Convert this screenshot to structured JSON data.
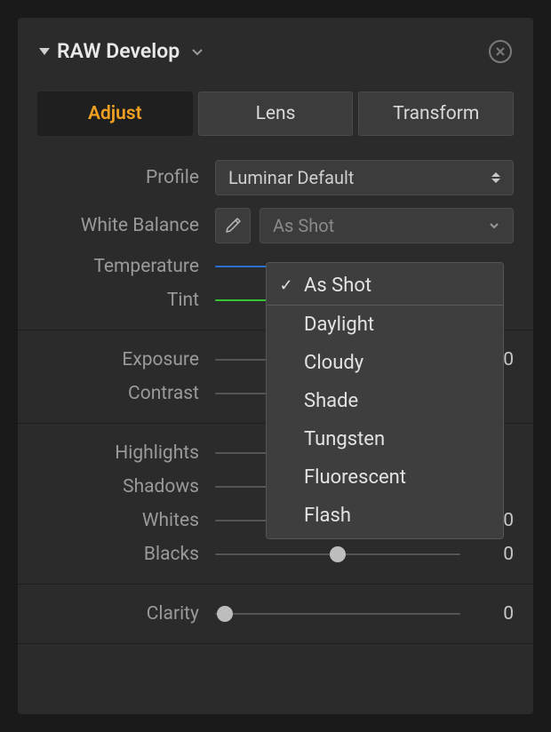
{
  "title": "RAW Develop",
  "tabs": {
    "adjust": "Adjust",
    "lens": "Lens",
    "transform": "Transform"
  },
  "profile": {
    "label": "Profile",
    "selected": "Luminar Default"
  },
  "white_balance": {
    "label": "White Balance",
    "selected": "As Shot",
    "options": [
      "As Shot",
      "Daylight",
      "Cloudy",
      "Shade",
      "Tungsten",
      "Fluorescent",
      "Flash"
    ]
  },
  "sliders": {
    "temperature": {
      "label": "Temperature",
      "value": ""
    },
    "tint": {
      "label": "Tint",
      "value": ""
    },
    "exposure": {
      "label": "Exposure",
      "value": "0"
    },
    "contrast": {
      "label": "Contrast",
      "value": ""
    },
    "highlights": {
      "label": "Highlights",
      "value": ""
    },
    "shadows": {
      "label": "Shadows",
      "value": ""
    },
    "whites": {
      "label": "Whites",
      "value": "0"
    },
    "blacks": {
      "label": "Blacks",
      "value": "0"
    },
    "clarity": {
      "label": "Clarity",
      "value": "0"
    }
  }
}
